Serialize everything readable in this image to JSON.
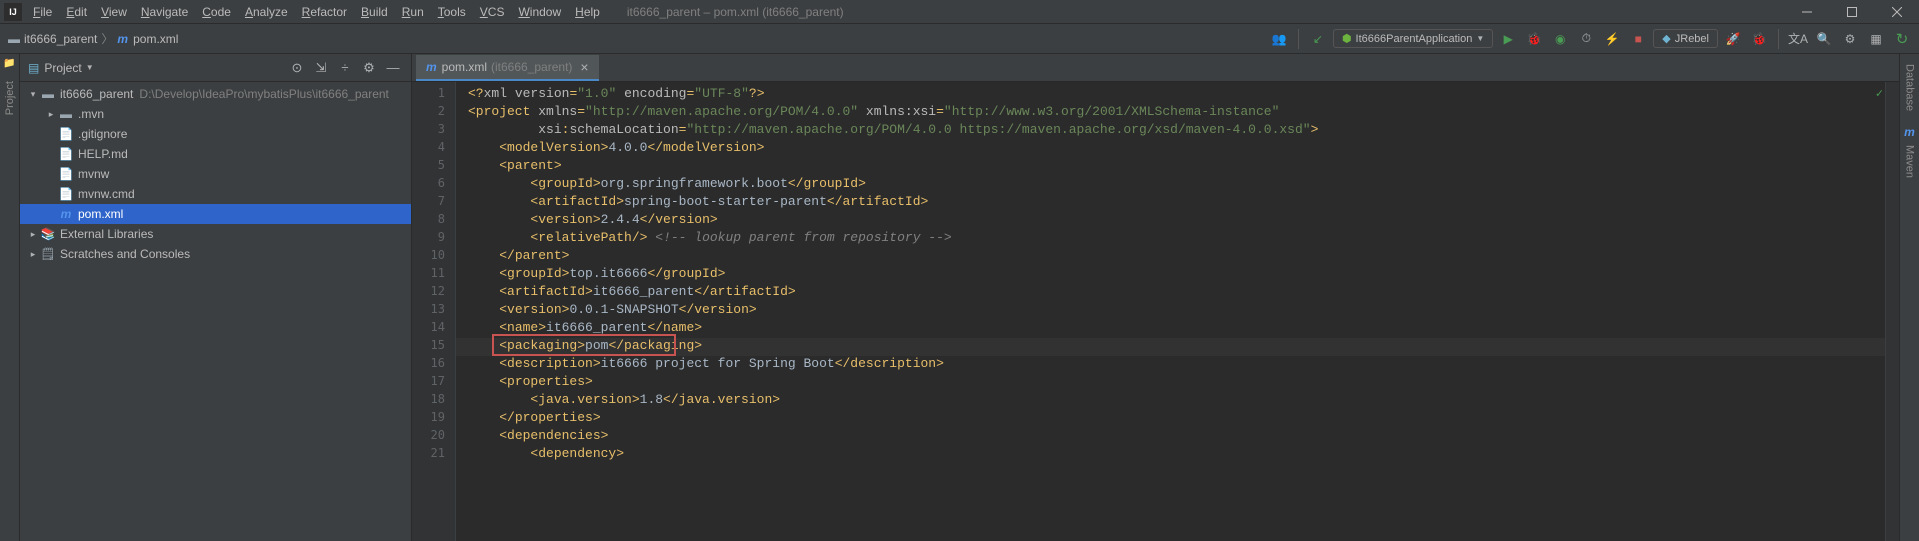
{
  "menubar": [
    "File",
    "Edit",
    "View",
    "Navigate",
    "Code",
    "Analyze",
    "Refactor",
    "Build",
    "Run",
    "Tools",
    "VCS",
    "Window",
    "Help"
  ],
  "titlebar_title": "it6666_parent – pom.xml (it6666_parent)",
  "breadcrumb": {
    "root": "it6666_parent",
    "file": "pom.xml"
  },
  "run_config_label": "It6666ParentApplication",
  "jrebel_label": "JRebel",
  "project_panel_title": "Project",
  "sidebar_left_label": "Project",
  "sidebar_right_labels": [
    "Database",
    "Maven"
  ],
  "tree": {
    "root": {
      "name": "it6666_parent",
      "path": "D:\\Develop\\IdeaPro\\mybatisPlus\\it6666_parent"
    },
    "items": [
      ".mvn",
      ".gitignore",
      "HELP.md",
      "mvnw",
      "mvnw.cmd",
      "pom.xml"
    ],
    "ext_libs": "External Libraries",
    "scratches": "Scratches and Consoles"
  },
  "tab": {
    "name": "pom.xml",
    "sub": "(it6666_parent)"
  },
  "code_lines": [
    {
      "n": 1,
      "seg": [
        {
          "c": "t-tag",
          "t": "<?"
        },
        {
          "c": "t-attr",
          "t": "xml version"
        },
        {
          "c": "t-tag",
          "t": "="
        },
        {
          "c": "t-str",
          "t": "\"1.0\""
        },
        {
          "c": "t-attr",
          "t": " encoding"
        },
        {
          "c": "t-tag",
          "t": "="
        },
        {
          "c": "t-str",
          "t": "\"UTF-8\""
        },
        {
          "c": "t-tag",
          "t": "?>"
        }
      ],
      "ind": 0
    },
    {
      "n": 2,
      "seg": [
        {
          "c": "t-tag",
          "t": "<project "
        },
        {
          "c": "t-attr",
          "t": "xmlns"
        },
        {
          "c": "t-tag",
          "t": "="
        },
        {
          "c": "t-str",
          "t": "\"http://maven.apache.org/POM/4.0.0\""
        },
        {
          "c": "t-attr",
          "t": " xmlns:"
        },
        {
          "c": "t-attr",
          "t": "xsi"
        },
        {
          "c": "t-tag",
          "t": "="
        },
        {
          "c": "t-str",
          "t": "\"http://www.w3.org/2001/XMLSchema-instance\""
        }
      ],
      "ind": 0
    },
    {
      "n": 3,
      "seg": [
        {
          "c": "t-attr",
          "t": "xsi"
        },
        {
          "c": "t-tag",
          "t": ":"
        },
        {
          "c": "t-attr",
          "t": "schemaLocation"
        },
        {
          "c": "t-tag",
          "t": "="
        },
        {
          "c": "t-str",
          "t": "\"http://maven.apache.org/POM/4.0.0 https://maven.apache.org/xsd/maven-4.0.0.xsd\""
        },
        {
          "c": "t-tag",
          "t": ">"
        }
      ],
      "ind": 9
    },
    {
      "n": 4,
      "seg": [
        {
          "c": "t-tag",
          "t": "<modelVersion>"
        },
        {
          "c": "t-text",
          "t": "4.0.0"
        },
        {
          "c": "t-tag",
          "t": "</modelVersion>"
        }
      ],
      "ind": 4
    },
    {
      "n": 5,
      "seg": [
        {
          "c": "t-tag",
          "t": "<parent>"
        }
      ],
      "ind": 4
    },
    {
      "n": 6,
      "seg": [
        {
          "c": "t-tag",
          "t": "<groupId>"
        },
        {
          "c": "t-text",
          "t": "org.springframework.boot"
        },
        {
          "c": "t-tag",
          "t": "</groupId>"
        }
      ],
      "ind": 8
    },
    {
      "n": 7,
      "seg": [
        {
          "c": "t-tag",
          "t": "<artifactId>"
        },
        {
          "c": "t-text",
          "t": "spring-boot-starter-parent"
        },
        {
          "c": "t-tag",
          "t": "</artifactId>"
        }
      ],
      "ind": 8
    },
    {
      "n": 8,
      "seg": [
        {
          "c": "t-tag",
          "t": "<version>"
        },
        {
          "c": "t-text",
          "t": "2.4.4"
        },
        {
          "c": "t-tag",
          "t": "</version>"
        }
      ],
      "ind": 8
    },
    {
      "n": 9,
      "seg": [
        {
          "c": "t-tag",
          "t": "<relativePath/>"
        },
        {
          "c": "t-text",
          "t": " "
        },
        {
          "c": "t-comment",
          "t": "<!-- lookup parent from repository -->"
        }
      ],
      "ind": 8
    },
    {
      "n": 10,
      "seg": [
        {
          "c": "t-tag",
          "t": "</parent>"
        }
      ],
      "ind": 4
    },
    {
      "n": 11,
      "seg": [
        {
          "c": "t-tag",
          "t": "<groupId>"
        },
        {
          "c": "t-text",
          "t": "top.it6666"
        },
        {
          "c": "t-tag",
          "t": "</groupId>"
        }
      ],
      "ind": 4
    },
    {
      "n": 12,
      "seg": [
        {
          "c": "t-tag",
          "t": "<artifactId>"
        },
        {
          "c": "t-text",
          "t": "it6666_parent"
        },
        {
          "c": "t-tag",
          "t": "</artifactId>"
        }
      ],
      "ind": 4
    },
    {
      "n": 13,
      "seg": [
        {
          "c": "t-tag",
          "t": "<version>"
        },
        {
          "c": "t-text",
          "t": "0.0.1-SNAPSHOT"
        },
        {
          "c": "t-tag",
          "t": "</version>"
        }
      ],
      "ind": 4
    },
    {
      "n": 14,
      "seg": [
        {
          "c": "t-tag",
          "t": "<name>"
        },
        {
          "c": "t-text",
          "t": "it6666_parent"
        },
        {
          "c": "t-tag",
          "t": "</name>"
        }
      ],
      "ind": 4
    },
    {
      "n": 15,
      "seg": [
        {
          "c": "t-tag",
          "t": "<packaging>"
        },
        {
          "c": "t-text",
          "t": "pom"
        },
        {
          "c": "t-tag",
          "t": "</packaging>"
        }
      ],
      "ind": 4,
      "hl": true,
      "box": true
    },
    {
      "n": 16,
      "seg": [
        {
          "c": "t-tag",
          "t": "<description>"
        },
        {
          "c": "t-text",
          "t": "it6666 project for Spring Boot"
        },
        {
          "c": "t-tag",
          "t": "</description>"
        }
      ],
      "ind": 4
    },
    {
      "n": 17,
      "seg": [
        {
          "c": "t-tag",
          "t": "<properties>"
        }
      ],
      "ind": 4
    },
    {
      "n": 18,
      "seg": [
        {
          "c": "t-tag",
          "t": "<java.version>"
        },
        {
          "c": "t-text",
          "t": "1.8"
        },
        {
          "c": "t-tag",
          "t": "</java.version>"
        }
      ],
      "ind": 8
    },
    {
      "n": 19,
      "seg": [
        {
          "c": "t-tag",
          "t": "</properties>"
        }
      ],
      "ind": 4
    },
    {
      "n": 20,
      "seg": [
        {
          "c": "t-tag",
          "t": "<dependencies>"
        }
      ],
      "ind": 4
    },
    {
      "n": 21,
      "seg": [
        {
          "c": "t-tag",
          "t": "<dependency>"
        }
      ],
      "ind": 8
    }
  ]
}
